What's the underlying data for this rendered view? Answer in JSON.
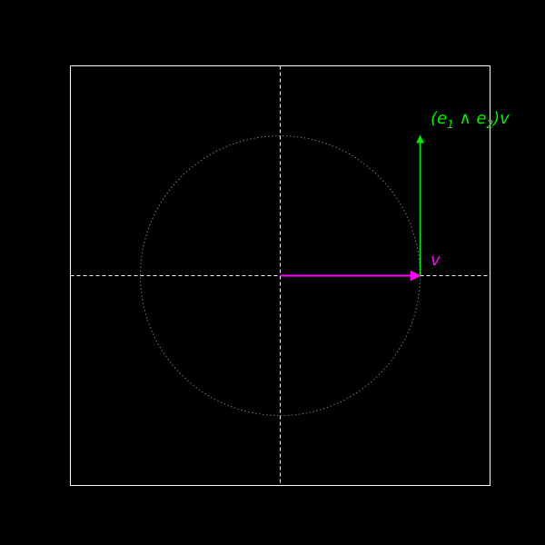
{
  "colors": {
    "background": "#000000",
    "frame": "#ffffff",
    "axes": "#ffffff",
    "circle": "#777777",
    "vector_v": "#ff00ff",
    "vector_rotated": "#00ee00"
  },
  "diagram": {
    "x_range": [
      -1.5,
      1.5
    ],
    "y_range": [
      -1.5,
      1.5
    ],
    "unit_circle": {
      "center": [
        0,
        0
      ],
      "radius": 1,
      "style": "dotted"
    },
    "axes": {
      "style": "dashed",
      "through_origin": true
    },
    "vectors": [
      {
        "id": "v",
        "from": [
          0,
          0
        ],
        "to": [
          1,
          0
        ],
        "label": "v"
      },
      {
        "id": "rotated",
        "from": [
          1,
          0
        ],
        "to": [
          1,
          1
        ],
        "label_prefix": "(e",
        "label_sub1": "1",
        "label_wedge": " ∧ e",
        "label_sub2": "2",
        "label_suffix": ")v"
      }
    ]
  }
}
